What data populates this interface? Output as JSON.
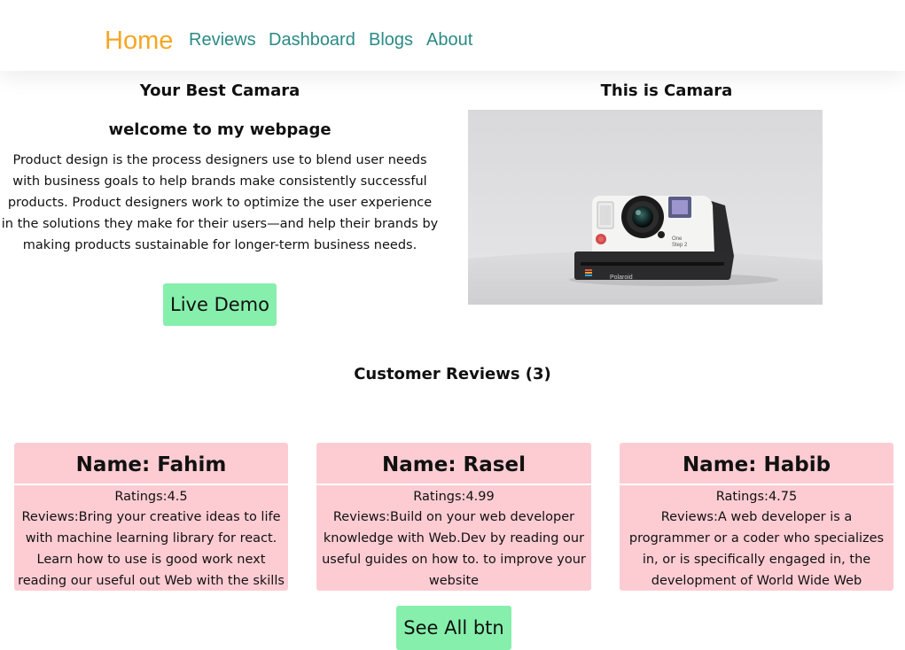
{
  "nav": {
    "home": "Home",
    "reviews": "Reviews",
    "dashboard": "Dashboard",
    "blogs": "Blogs",
    "about": "About"
  },
  "hero": {
    "title": "Your Best Camara",
    "subtitle": "welcome to my webpage",
    "description": "Product design is the process designers use to blend user needs with business goals to help brands make consistently successful products. Product designers work to optimize the user experience in the solutions they make for their users—and help their brands by making products sustainable for longer-term business needs.",
    "demo_button": "Live Demo",
    "image_title": "This is Camara"
  },
  "reviews": {
    "heading": "Customer Reviews (3)",
    "items": [
      {
        "name": "Name: Fahim",
        "rating": "Ratings:4.5",
        "review": "Reviews:Bring your creative ideas to life with machine learning library for react. Learn how to use is good work next reading our useful out Web with the skills"
      },
      {
        "name": "Name: Rasel",
        "rating": "Ratings:4.99",
        "review": "Reviews:Build on your web developer knowledge with Web.Dev by reading our useful guides on how to. to improve your website"
      },
      {
        "name": "Name: Habib",
        "rating": "Ratings:4.75",
        "review": "Reviews:A web developer is a programmer or a coder who specializes in, or is specifically engaged in, the development of World Wide Web applications using"
      }
    ],
    "see_all_button": "See All btn"
  },
  "colors": {
    "nav_active": "#f5a623",
    "nav_link": "#2a8a86",
    "button_bg": "#86efac",
    "card_bg": "#fdccd3"
  }
}
